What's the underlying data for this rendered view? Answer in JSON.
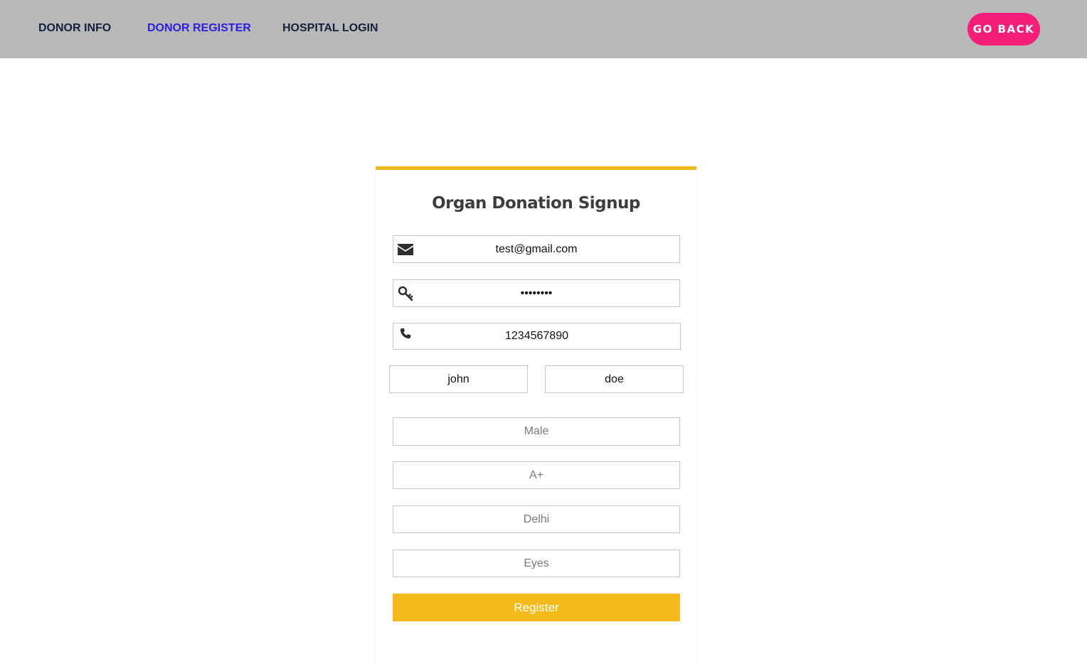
{
  "nav": {
    "items": [
      {
        "label": "DONOR INFO"
      },
      {
        "label": "DONOR REGISTER"
      },
      {
        "label": "HOSPITAL LOGIN"
      }
    ],
    "go_back_label": "GO BACK"
  },
  "colors": {
    "topbar": "#b8b8b8",
    "nav_text": "#14213d",
    "nav_active": "#2a1ee0",
    "go_back_bg": "#f51e78",
    "accent": "#f4b91b"
  },
  "form": {
    "title": "Organ Donation Signup",
    "email": {
      "value": "test@gmail.com",
      "icon": "envelope-icon"
    },
    "password": {
      "value": "abcdefgh",
      "icon": "key-icon"
    },
    "phone": {
      "value": "1234567890",
      "icon": "phone-icon"
    },
    "first_name": {
      "value": "john"
    },
    "last_name": {
      "value": "doe"
    },
    "gender": {
      "placeholder": "Male"
    },
    "blood_group": {
      "placeholder": "A+"
    },
    "city": {
      "placeholder": "Delhi"
    },
    "organ": {
      "placeholder": "Eyes"
    },
    "register_label": "Register"
  }
}
